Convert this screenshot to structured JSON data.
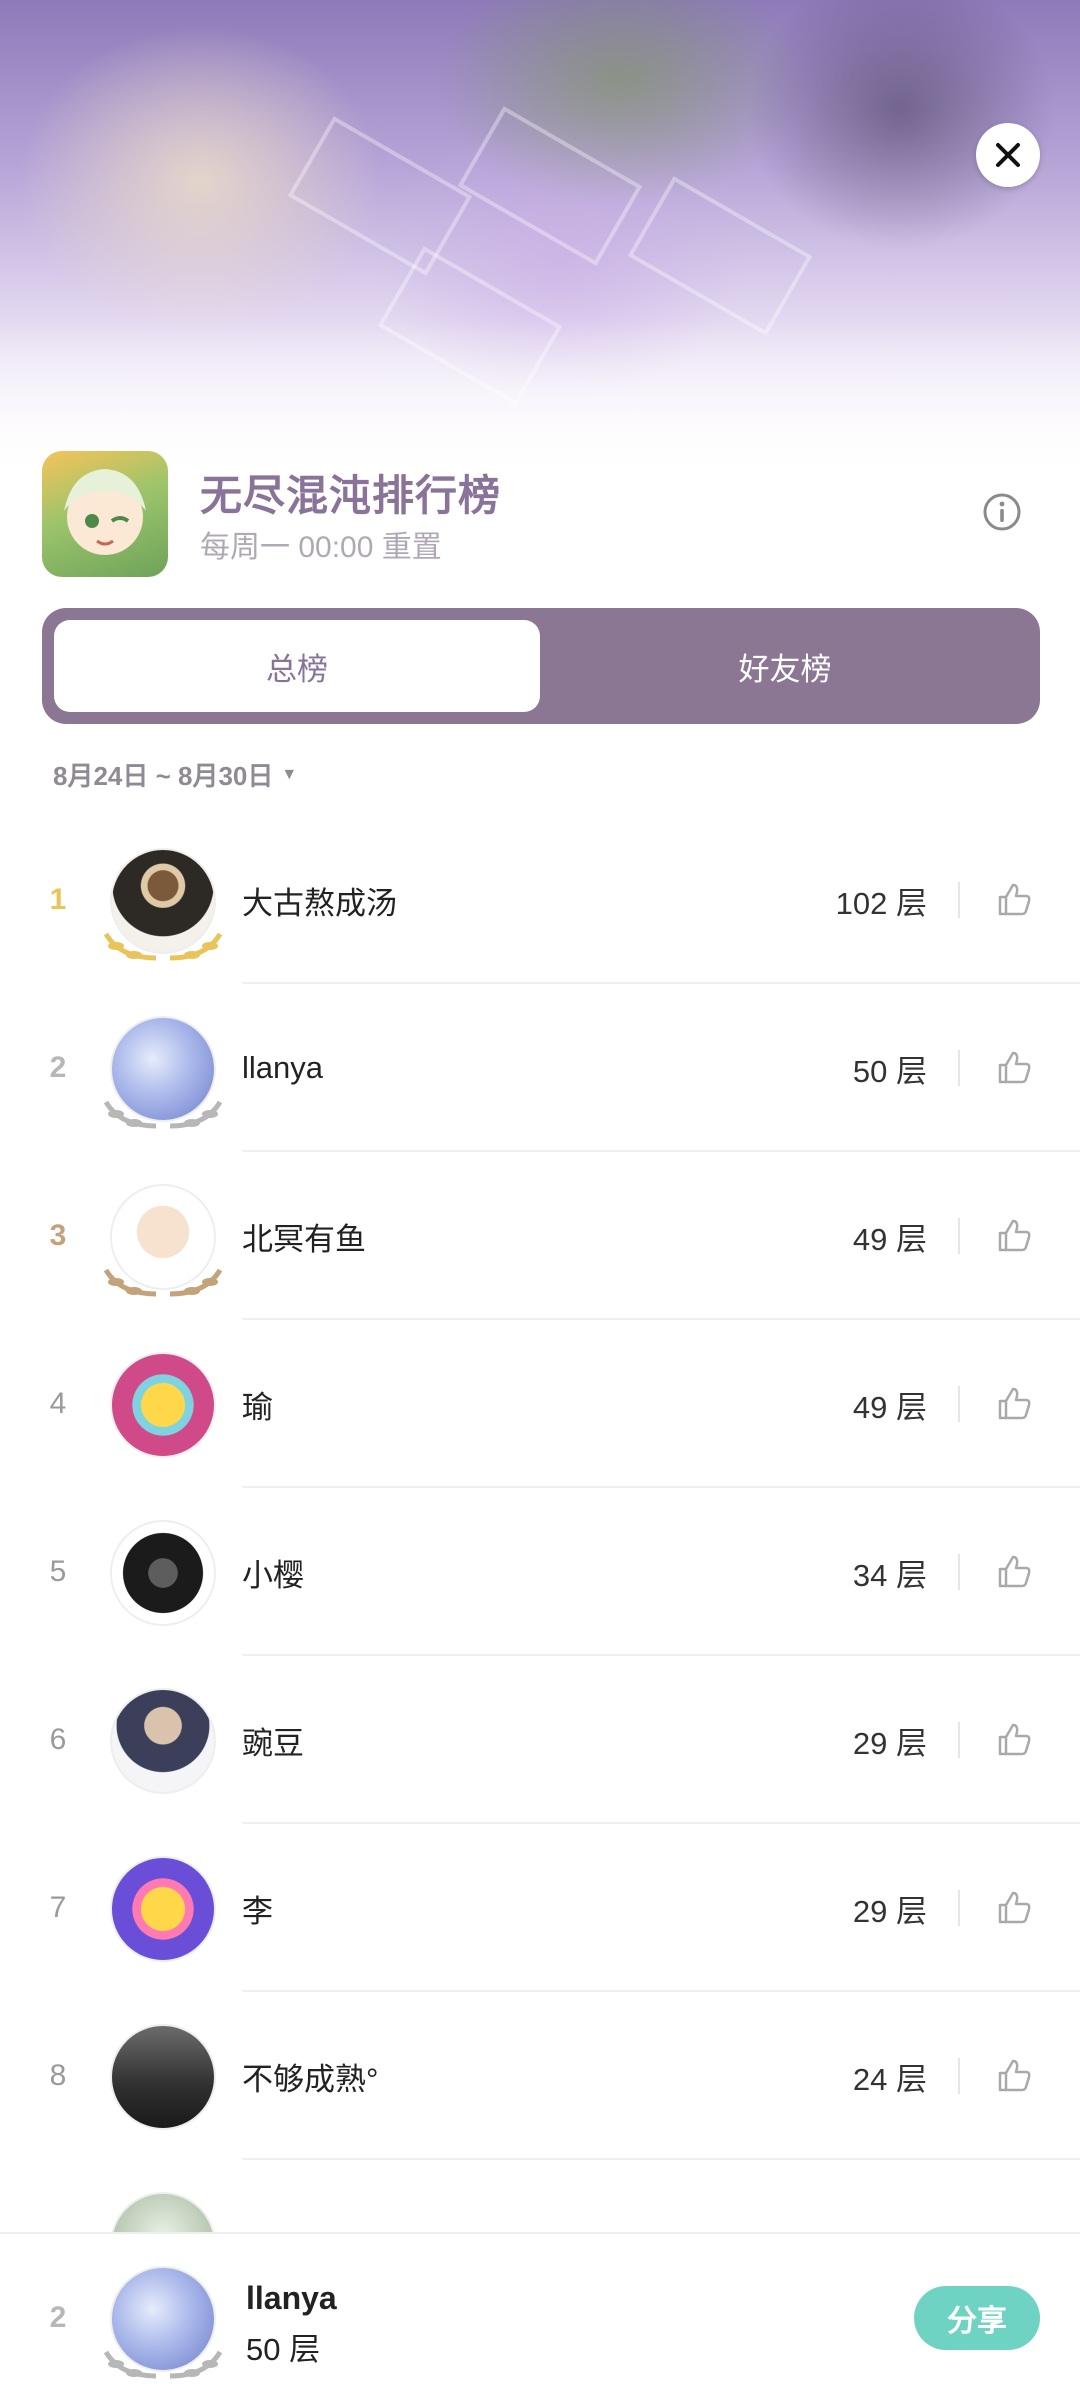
{
  "header": {
    "title": "无尽混沌排行榜",
    "subtitle": "每周一 00:00 重置"
  },
  "tabs": [
    {
      "label": "总榜",
      "active": true
    },
    {
      "label": "好友榜",
      "active": false
    }
  ],
  "date_range": "8月24日 ~ 8月30日",
  "rows": [
    {
      "rank": "1",
      "name": "大古熬成汤",
      "score": "102 层"
    },
    {
      "rank": "2",
      "name": "llanya",
      "score": "50 层"
    },
    {
      "rank": "3",
      "name": "北冥有鱼",
      "score": "49 层"
    },
    {
      "rank": "4",
      "name": "瑜",
      "score": "49 层"
    },
    {
      "rank": "5",
      "name": "小樱",
      "score": "34 层"
    },
    {
      "rank": "6",
      "name": "豌豆",
      "score": "29 层"
    },
    {
      "rank": "7",
      "name": "李",
      "score": "29 层"
    },
    {
      "rank": "8",
      "name": "不够成熟°",
      "score": "24 层"
    }
  ],
  "my_rank": {
    "rank": "2",
    "name": "llanya",
    "score": "50 层",
    "share_label": "分享"
  },
  "colors": {
    "accent": "#8b7693",
    "title": "#8a7399",
    "share": "#6fd3c4",
    "gold": "#e8c45a",
    "silver": "#b7b7b7",
    "bronze": "#c4a27a"
  },
  "icons": {
    "close": "close-icon",
    "info": "info-icon",
    "like": "thumbs-up-icon",
    "dropdown": "caret-down-icon"
  }
}
